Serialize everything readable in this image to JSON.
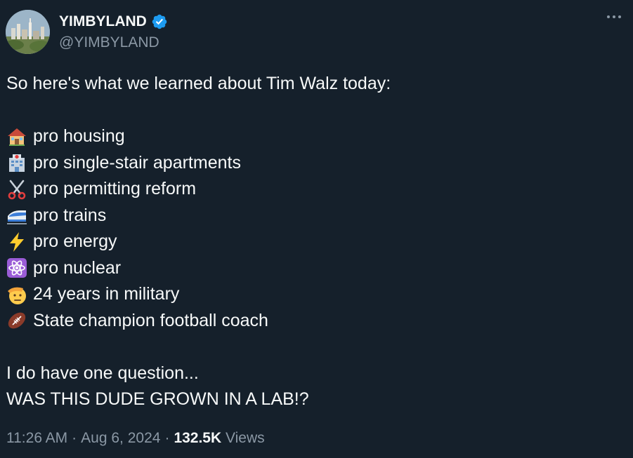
{
  "author": {
    "display_name": "YIMBYLAND",
    "handle": "@YIMBYLAND",
    "verified": true,
    "verified_color": "#1d9bf0"
  },
  "more_icon": "more-horizontal-icon",
  "tweet": {
    "intro": "So here's what we learned about Tim Walz today:",
    "list": [
      {
        "icon": "house-icon",
        "text": "pro housing"
      },
      {
        "icon": "hospital-building-icon",
        "text": "pro single-stair apartments"
      },
      {
        "icon": "scissors-icon",
        "text": "pro permitting reform"
      },
      {
        "icon": "bullet-train-icon",
        "text": "pro trains"
      },
      {
        "icon": "lightning-icon",
        "text": "pro energy"
      },
      {
        "icon": "atom-icon",
        "text": "pro nuclear"
      },
      {
        "icon": "saluting-face-icon",
        "text": "24 years in military"
      },
      {
        "icon": "football-icon",
        "text": "State champion football coach"
      }
    ],
    "outro_1": "I do have one question...",
    "outro_2": "WAS THIS DUDE GROWN IN A LAB!?"
  },
  "meta": {
    "time": "11:26 AM",
    "separator": "·",
    "date": "Aug 6, 2024",
    "views_count": "132.5K",
    "views_label": "Views"
  },
  "colors": {
    "background": "#15202b",
    "text_primary": "#f7f9f9",
    "text_secondary": "#8b98a5"
  }
}
